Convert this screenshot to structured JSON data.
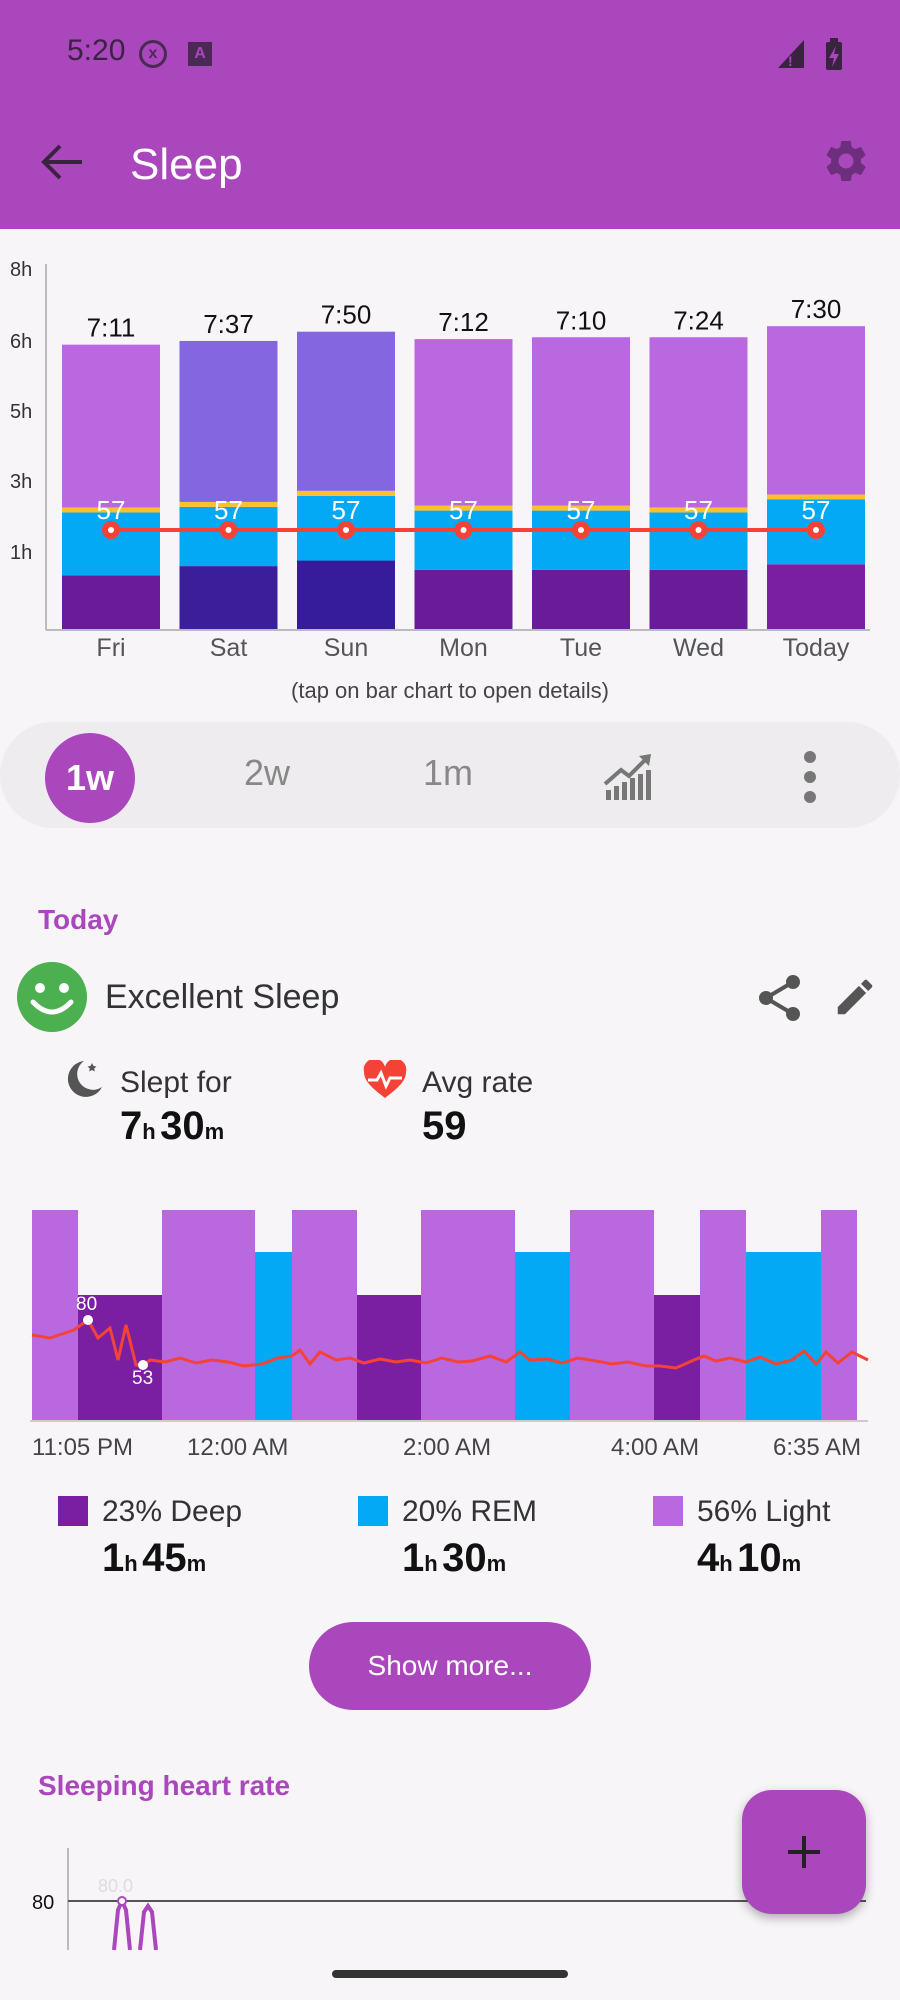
{
  "status_bar": {
    "time": "5:20"
  },
  "header": {
    "title": "Sleep"
  },
  "week_chart": {
    "y_ticks": [
      "8h",
      "6h",
      "5h",
      "3h",
      "1h"
    ],
    "days": [
      "Fri",
      "Sat",
      "Sun",
      "Mon",
      "Tue",
      "Wed",
      "Today"
    ],
    "durations": [
      "7:11",
      "7:37",
      "7:50",
      "7:12",
      "7:10",
      "7:24",
      "7:30"
    ],
    "hr_labels": [
      "57",
      "57",
      "57",
      "57",
      "57",
      "57",
      "57"
    ],
    "hint": "(tap on bar chart to open details)"
  },
  "chart_data": {
    "type": "bar",
    "categories": [
      "Fri",
      "Sat",
      "Sun",
      "Mon",
      "Tue",
      "Wed",
      "Today"
    ],
    "series": [
      {
        "name": "Deep",
        "values": [
          1.45,
          1.7,
          1.85,
          1.6,
          1.6,
          1.6,
          1.75
        ]
      },
      {
        "name": "REM",
        "values": [
          1.7,
          1.6,
          1.75,
          1.6,
          1.6,
          1.55,
          1.75
        ]
      },
      {
        "name": "Light",
        "values": [
          4.4,
          4.35,
          4.3,
          4.5,
          4.55,
          4.6,
          4.55
        ]
      }
    ],
    "labels": [
      "7:11",
      "7:37",
      "7:50",
      "7:12",
      "7:10",
      "7:24",
      "7:30"
    ],
    "heart_rate": [
      57,
      57,
      57,
      57,
      57,
      57,
      57
    ],
    "ylim": [
      0,
      8.5
    ]
  },
  "periods": {
    "active": "1w",
    "options": [
      "2w",
      "1m"
    ]
  },
  "today": {
    "section_label": "Today",
    "quality": "Excellent Sleep",
    "slept_label": "Slept for",
    "slept_hours": "7",
    "slept_minutes": "30",
    "avg_label": "Avg rate",
    "avg_value": "59"
  },
  "units": {
    "h": "h",
    "m": "m"
  },
  "hypnogram": {
    "times": [
      "11:05 PM",
      "12:00 AM",
      "2:00 AM",
      "4:00 AM",
      "6:35 AM"
    ],
    "hr_max_label": "80",
    "hr_min_label": "53"
  },
  "stages": [
    {
      "label": "23% Deep",
      "hours": "1",
      "minutes": "45",
      "color": "#7b1fa2"
    },
    {
      "label": "20% REM",
      "hours": "1",
      "minutes": "30",
      "color": "#03a9f4"
    },
    {
      "label": "56% Light",
      "hours": "4",
      "minutes": "10",
      "color": "#ba68e0"
    }
  ],
  "show_more_label": "Show more...",
  "heart_rate_section": {
    "title": "Sleeping heart rate",
    "y_label": "80",
    "peak_label": "80.0"
  },
  "colors": {
    "accent": "#ab47bc",
    "deep": "#7b1fa2",
    "rem": "#03a9f4",
    "light": "#ba68e0",
    "hr_line": "#f44336"
  }
}
